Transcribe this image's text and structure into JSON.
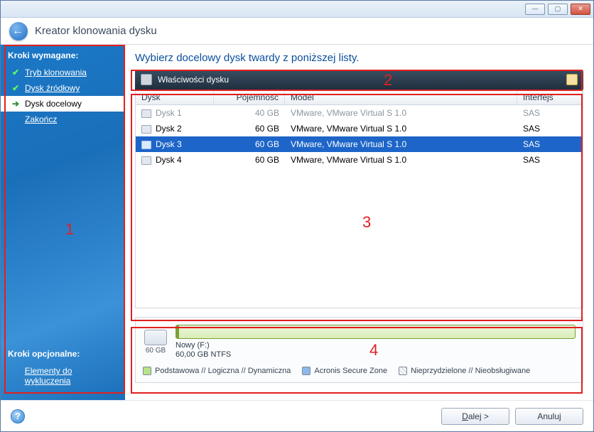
{
  "window": {
    "title": "Kreator klonowania dysku"
  },
  "sidebar": {
    "required_heading": "Kroki wymagane:",
    "optional_heading": "Kroki opcjonalne:",
    "items": [
      {
        "label": "Tryb klonowania",
        "status": "done"
      },
      {
        "label": "Dysk źródłowy",
        "status": "done"
      },
      {
        "label": "Dysk docelowy",
        "status": "current"
      },
      {
        "label": "Zakończ",
        "status": "pending"
      }
    ],
    "optional_items": [
      {
        "label": "Elementy do wykluczenia"
      }
    ]
  },
  "main": {
    "instruction": "Wybierz docelowy dysk twardy z poniższej listy.",
    "propbar_label": "Właściwości dysku",
    "columns": {
      "disk": "Dysk",
      "capacity": "Pojemność",
      "model": "Model",
      "interface": "Interfejs"
    },
    "rows": [
      {
        "disk": "Dysk 1",
        "capacity": "40 GB",
        "model": "VMware, VMware Virtual S 1.0",
        "interface": "SAS",
        "disabled": true,
        "selected": false
      },
      {
        "disk": "Dysk 2",
        "capacity": "60 GB",
        "model": "VMware, VMware Virtual S 1.0",
        "interface": "SAS",
        "disabled": false,
        "selected": false
      },
      {
        "disk": "Dysk 3",
        "capacity": "60 GB",
        "model": "VMware, VMware Virtual S 1.0",
        "interface": "SAS",
        "disabled": false,
        "selected": true
      },
      {
        "disk": "Dysk 4",
        "capacity": "60 GB",
        "model": "VMware, VMware Virtual S 1.0",
        "interface": "SAS",
        "disabled": false,
        "selected": false
      }
    ],
    "partition": {
      "total": "60 GB",
      "name": "Nowy (F:)",
      "detail": "60,00 GB  NTFS"
    },
    "legend": {
      "primary": "Podstawowa // Logiczna // Dynamiczna",
      "asz": "Acronis Secure Zone",
      "unalloc": "Nieprzydzielone // Nieobsługiwane"
    }
  },
  "footer": {
    "next": "Dalej >",
    "next_hotkey": "D",
    "cancel": "Anuluj"
  },
  "annotations": {
    "n1": "1",
    "n2": "2",
    "n3": "3",
    "n4": "4"
  }
}
